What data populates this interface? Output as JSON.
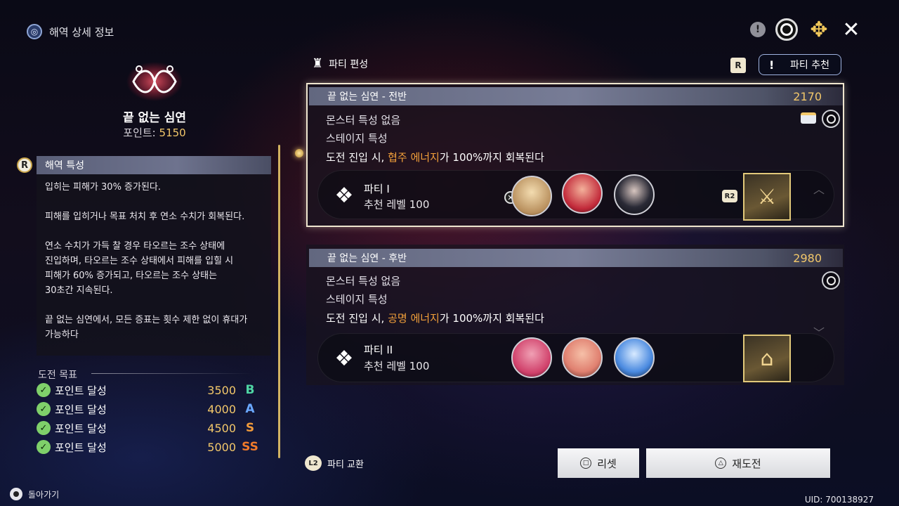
{
  "header": {
    "title": "해역 상세 정보"
  },
  "stage": {
    "name": "끝 없는 심연",
    "points_label": "포인트:",
    "points_value": "5150"
  },
  "traits": {
    "badge": "R",
    "title": "해역 특성",
    "text": "입히는 피해가 30% 증가된다.\n\n피해를 입히거나 목표 처치 후 연소 수치가 회복된다.\n\n연소 수치가 가득 찰 경우 타오르는 조수 상태에\n진입하며, 타오르는 조수 상태에서 피해를 입힐 시\n피해가 60% 증가되고, 타오르는 조수 상태는\n30초간 지속된다.\n\n끝 없는 심연에서, 모든 증표는 횟수 제한 없이 휴대가\n가능하다"
  },
  "goals": {
    "title": "도전 목표",
    "items": [
      {
        "label": "포인트 달성",
        "value": "3500",
        "rank": "B"
      },
      {
        "label": "포인트 달성",
        "value": "4000",
        "rank": "A"
      },
      {
        "label": "포인트 달성",
        "value": "4500",
        "rank": "S"
      },
      {
        "label": "포인트 달성",
        "value": "5000",
        "rank": "SS"
      }
    ]
  },
  "back": {
    "label": "돌아가기"
  },
  "party_edit": {
    "title": "파티 편성",
    "recommend_badge": "R",
    "recommend_label": "파티 추천",
    "recommend_mark": "!"
  },
  "stages": [
    {
      "title": "끝 없는 심연 - 전반",
      "points": "2170",
      "monster": "몬스터 특성  없음",
      "stage_trait": "스테이지 특성",
      "desc_pre": "도전 진입 시, ",
      "desc_hl": "협주 에너지",
      "desc_post": "가 100%까지 회복된다",
      "party_name": "파티 I",
      "party_level": "추천 레벨 100",
      "r2_badge": "R2"
    },
    {
      "title": "끝 없는 심연 - 후반",
      "points": "2980",
      "monster": "몬스터 특성  없음",
      "stage_trait": "스테이지 특성",
      "desc_pre": "도전 진입 시, ",
      "desc_hl": "공명 에너지",
      "desc_post": "가 100%까지 회복된다",
      "party_name": "파티 II",
      "party_level": "추천 레벨 100"
    }
  ],
  "footer": {
    "swap_badge": "L2",
    "swap_label": "파티 교환",
    "reset_label": "리셋",
    "retry_label": "재도전",
    "uid": "UID: 700138927"
  },
  "colors": {
    "accent_gold": "#f3c86a",
    "highlight_orange": "#f3a03a",
    "check_green": "#7fd06a"
  }
}
